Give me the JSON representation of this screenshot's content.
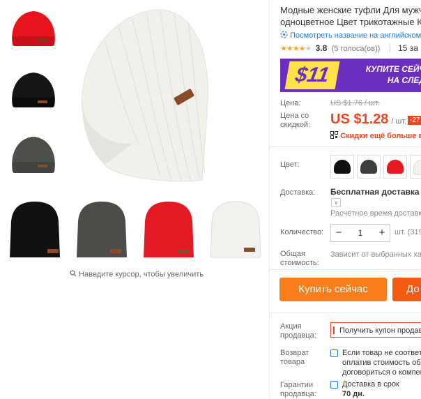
{
  "product": {
    "title_line1": "Модные женские туфли Для мужч",
    "title_line2": "одноцветное Цвет трикотажные К",
    "translate_link": "Посмотреть название на английском",
    "rating_value": "3.8",
    "votes": "(5 голоса(ов))",
    "orders": "15 за",
    "rating_stars": 3.8
  },
  "gallery": {
    "zoom_hint": "Наведите курсор, чтобы увеличить",
    "thumb_colors": [
      "#e8141e",
      "#151515",
      "#4d504a"
    ],
    "variant_colors": [
      "#111111",
      "#4d4c49",
      "#e31a23",
      "#f3f1ed"
    ]
  },
  "banner": {
    "price": "$11",
    "text_line1": "КУПИТЕ СЕЙЧ",
    "text_line2": "НА СЛЕД"
  },
  "price": {
    "label": "Цена:",
    "old": "US $1.76 / шт.",
    "discount_label": "Цена со скидкой:",
    "new": "US $1.28",
    "unit": "/ шт.",
    "discount": "-27",
    "promo": "Скидки ещё больше в п"
  },
  "color": {
    "label": "Цвет:",
    "swatches": [
      "#111111",
      "#3d3e3a",
      "#e31a23",
      "#f3f1ed"
    ]
  },
  "shipping": {
    "label": "Доставка:",
    "name": "Бесплатная доставка в Ru",
    "time": "Расчётное время доставки"
  },
  "quantity": {
    "label": "Количество:",
    "minus": "−",
    "value": "1",
    "plus": "+",
    "stock": "шт. (319"
  },
  "total": {
    "label": "Общая стоимость:",
    "value": "Зависит от выбранных хар"
  },
  "actions": {
    "buy": "Купить сейчас",
    "cart": "До"
  },
  "seller_promo": {
    "label": "Акция продавца:",
    "coupon": "Получить купон продавц"
  },
  "returns": {
    "label": "Возврат товара",
    "line1": "Если товар не соответс",
    "line2": "оплатив стоимость обр",
    "line3": "договориться о компен"
  },
  "guarantee": {
    "label": "Гарантии продавца:",
    "line1": "Доставка в срок",
    "line2": "70 дн."
  },
  "colors": {
    "accent_orange": "#f97e1b",
    "price_red": "#f0441e",
    "link_blue": "#2178d8",
    "banner_purple": "#6b2fbf"
  }
}
